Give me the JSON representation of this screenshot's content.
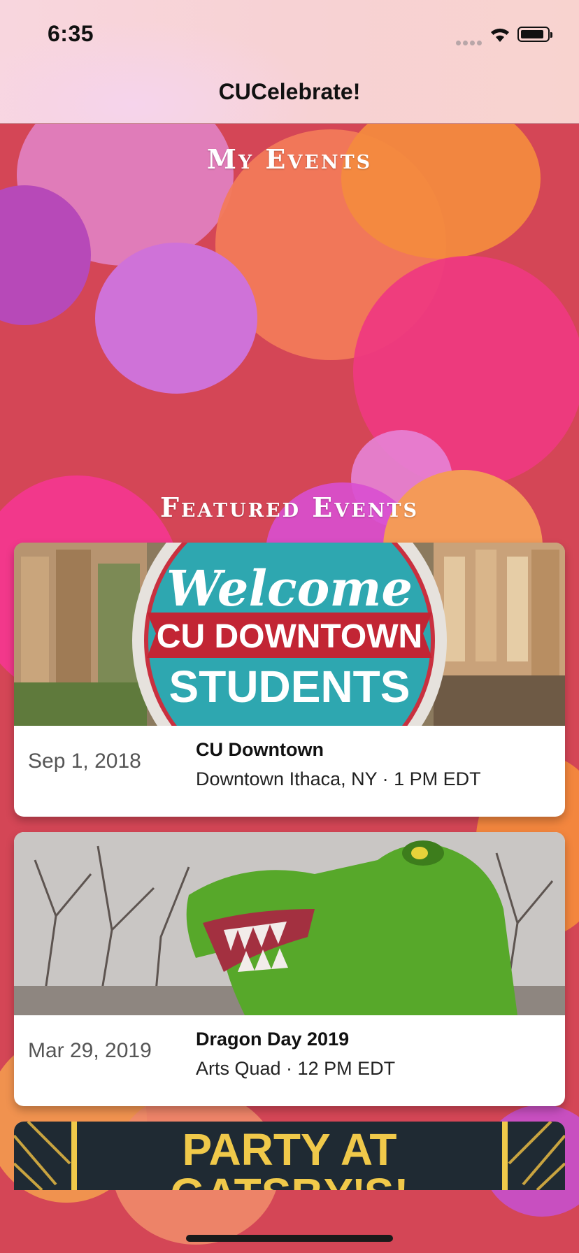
{
  "status_bar": {
    "time": "6:35"
  },
  "nav": {
    "title": "CUCelebrate!"
  },
  "sections": {
    "my_events": "My Events",
    "featured_events": "Featured Events"
  },
  "events": [
    {
      "date": "Sep 1, 2018",
      "name": "CU Downtown",
      "meta": "Downtown Ithaca, NY · 1 PM EDT",
      "image_text": {
        "line1": "Welcome",
        "line2": "CU DOWNTOWN",
        "line3": "STUDENTS"
      }
    },
    {
      "date": "Mar 29, 2019",
      "name": "Dragon Day 2019",
      "meta": "Arts Quad · 12 PM EDT"
    },
    {
      "image_text": {
        "line1": "PARTY AT",
        "line2": "GATSBY'S!"
      }
    }
  ],
  "colors": {
    "background": "#d44656",
    "nav_background": "#f7d2d4",
    "accent_orange": "#f08a4b",
    "accent_pink": "#f23a8a",
    "accent_purple": "#c66bd6"
  }
}
